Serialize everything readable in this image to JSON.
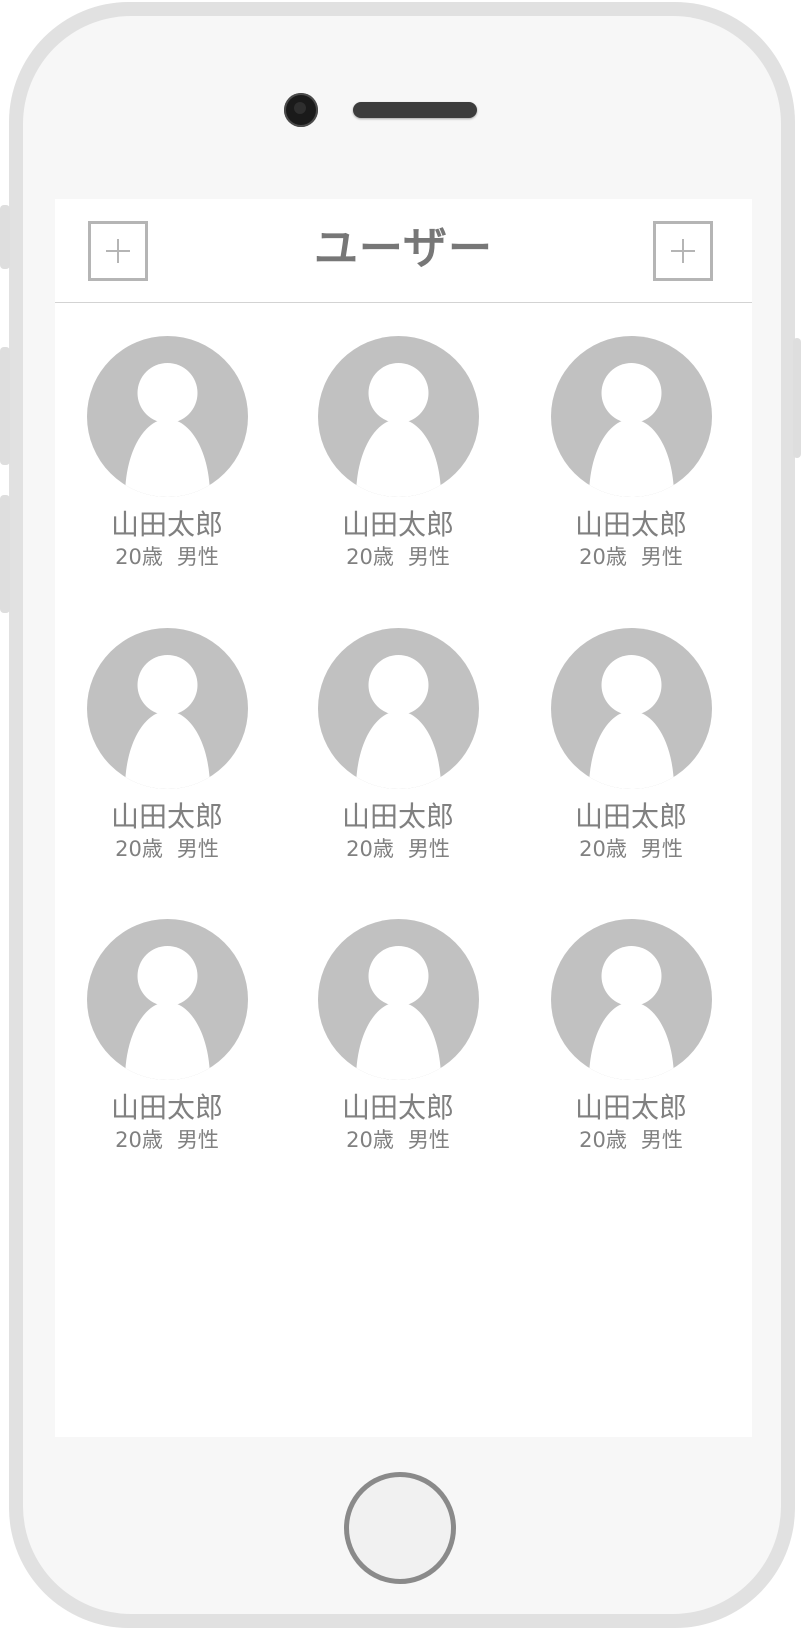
{
  "header": {
    "title": "ユーザー",
    "left_button_icon": "plus-icon",
    "right_button_icon": "plus-icon"
  },
  "users": [
    {
      "name": "山田太郎",
      "age": "20歳",
      "gender": "男性"
    },
    {
      "name": "山田太郎",
      "age": "20歳",
      "gender": "男性"
    },
    {
      "name": "山田太郎",
      "age": "20歳",
      "gender": "男性"
    },
    {
      "name": "山田太郎",
      "age": "20歳",
      "gender": "男性"
    },
    {
      "name": "山田太郎",
      "age": "20歳",
      "gender": "男性"
    },
    {
      "name": "山田太郎",
      "age": "20歳",
      "gender": "男性"
    },
    {
      "name": "山田太郎",
      "age": "20歳",
      "gender": "男性"
    },
    {
      "name": "山田太郎",
      "age": "20歳",
      "gender": "男性"
    },
    {
      "name": "山田太郎",
      "age": "20歳",
      "gender": "男性"
    }
  ],
  "colors": {
    "avatar": "#c1c1c1",
    "text": "#808080",
    "border": "#b5b5b5"
  }
}
